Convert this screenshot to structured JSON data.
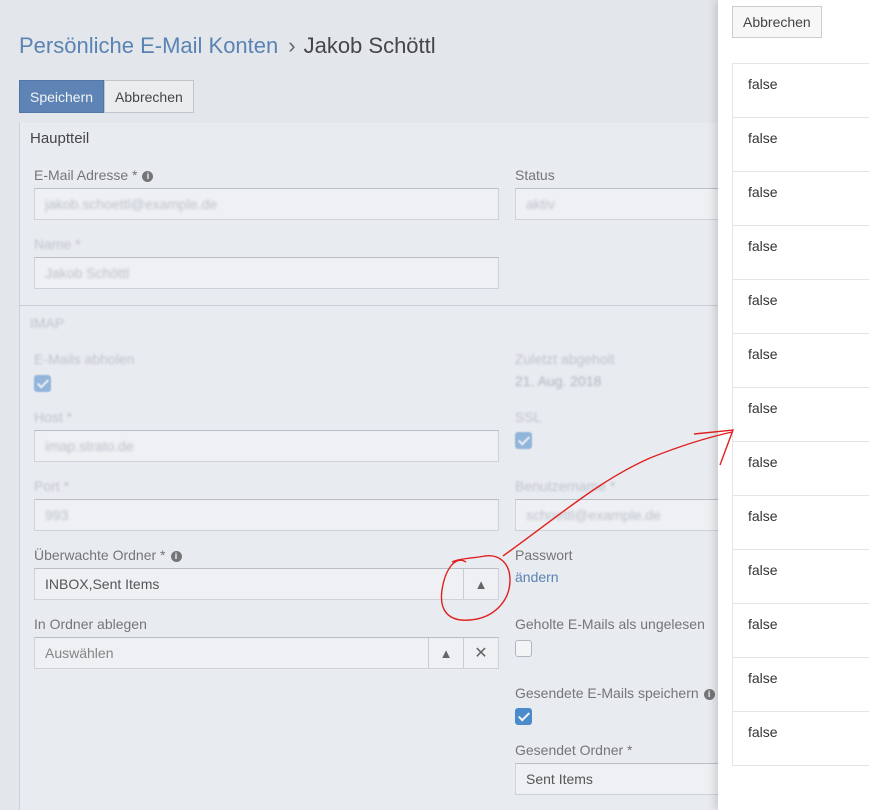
{
  "breadcrumb": {
    "parent": "Persönliche E-Mail Konten",
    "separator": "›",
    "current": "Jakob Schöttl"
  },
  "toolbar": {
    "save_label": "Speichern",
    "cancel_label": "Abbrechen"
  },
  "panel": {
    "title": "Hauptteil"
  },
  "form": {
    "email_label": "E-Mail Adresse *",
    "status_label": "Status",
    "watched_label": "Überwachte Ordner *",
    "watched_value": "INBOX,Sent Items",
    "password_label": "Passwort",
    "password_link": "ändern",
    "file_label": "In Ordner ablegen",
    "file_placeholder": "Auswählen",
    "fetched_label": "Geholte E-Mails als ungelesen",
    "save_sent_label": "Gesendete E-Mails speichern",
    "sent_folder_label": "Gesendet Ordner *",
    "sent_folder_value": "Sent Items"
  },
  "sidebar": {
    "cancel_label": "Abbrechen",
    "items": [
      "false",
      "false",
      "false",
      "false",
      "false",
      "false",
      "false",
      "false",
      "false",
      "false",
      "false",
      "false",
      "false"
    ]
  },
  "colors": {
    "accent": "#5e87b8",
    "annotation": "#e02020",
    "checkbox": "#4c8fd1"
  }
}
